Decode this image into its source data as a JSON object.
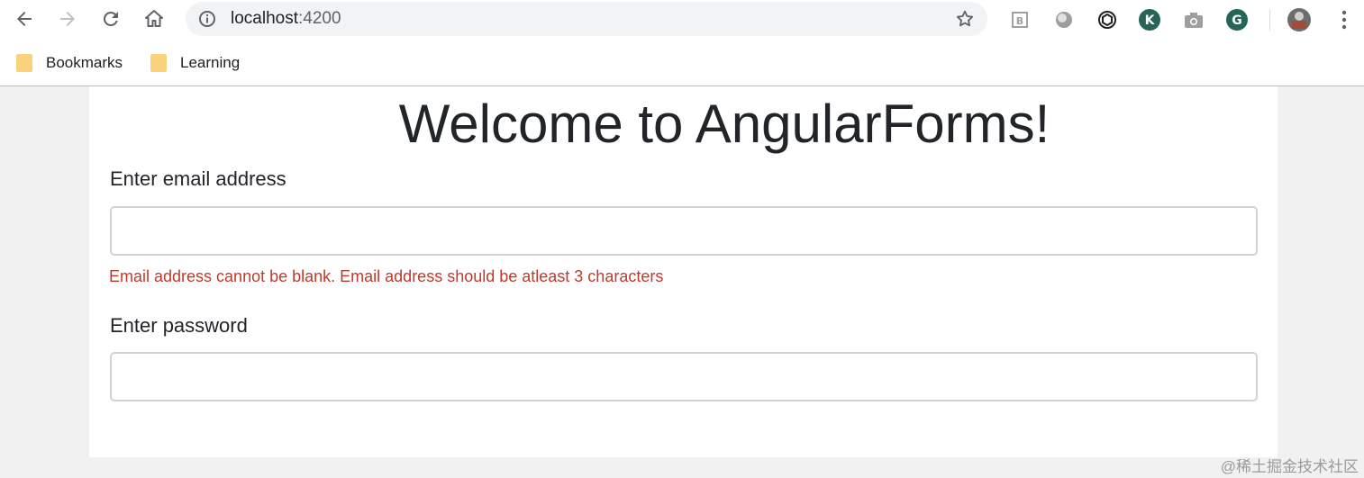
{
  "browser": {
    "url_host": "localhost",
    "url_port": ":4200",
    "bookmarks": [
      {
        "label": "Bookmarks",
        "icon": "folder-icon"
      },
      {
        "label": "Learning",
        "icon": "folder-icon"
      }
    ],
    "extension_icons": [
      "reader-icon",
      "sphere-icon",
      "openai-icon",
      "k-extension-icon",
      "camera-icon",
      "grammarly-icon"
    ],
    "colors": {
      "toolbar_bg": "#ffffff",
      "omnibox_bg": "#f1f3f4",
      "folder": "#fad27b"
    }
  },
  "page": {
    "title": "Welcome to AngularForms!",
    "email": {
      "label": "Enter email address",
      "value": "",
      "error": "Email address cannot be blank. Email address should be atleast 3 characters"
    },
    "password": {
      "label": "Enter password",
      "value": ""
    },
    "colors": {
      "error": "#c0392b",
      "text": "#212529",
      "input_border": "#ced4da"
    }
  },
  "watermark": "@稀土掘金技术社区"
}
